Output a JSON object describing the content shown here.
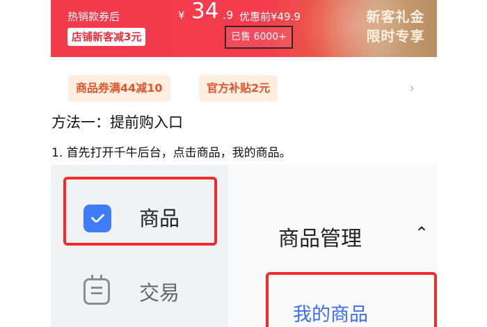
{
  "banner": {
    "hot_label": "热销款券后",
    "yen": "¥",
    "price_main": "34",
    "price_decimal": ".9",
    "original_price": "优惠前¥49.9",
    "store_discount": "店铺新客减3元",
    "sold": "已售 6000+",
    "title_line1": "新客礼金",
    "title_line2": "限时专享"
  },
  "coupons": [
    {
      "label": "商品券满44减10"
    },
    {
      "label": "官方补贴2元"
    }
  ],
  "article": {
    "method_heading": "方法一：提前购入口",
    "step1": "1. 首先打开千牛后台，点击商品，我的商品。"
  },
  "screenshot": {
    "sidebar": {
      "goods": "商品",
      "trade": "交易"
    },
    "content": {
      "management": "商品管理",
      "my_goods": "我的商品"
    }
  },
  "icons": {
    "chevron_right": "›",
    "chevron_up": "⌃"
  },
  "colors": {
    "banner_red": "#f23a4c",
    "highlight_red": "#ef2b2b",
    "icon_blue": "#3f7df6",
    "link_blue": "#3d6ef2",
    "coupon_bg": "#fdeee0",
    "coupon_text": "#e0562d"
  }
}
